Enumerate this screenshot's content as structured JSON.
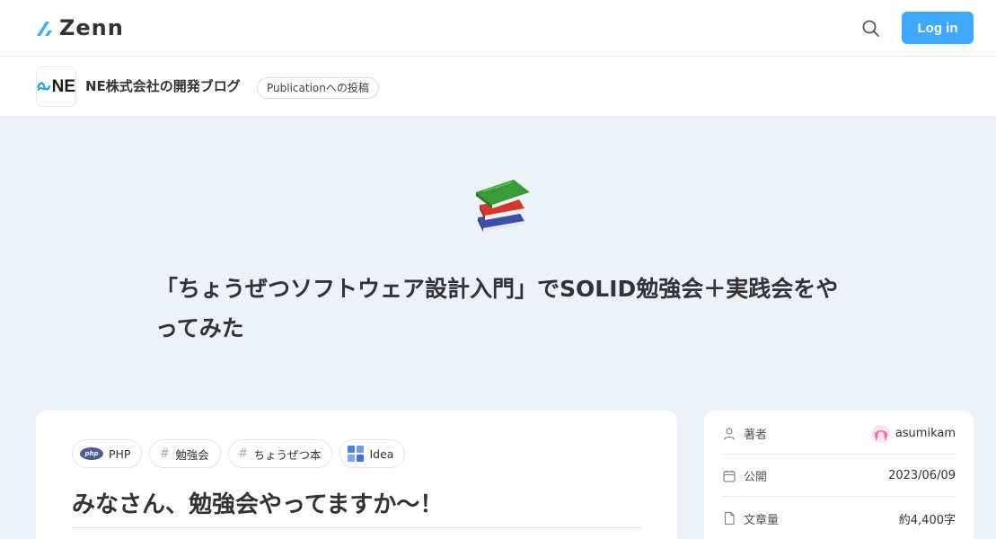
{
  "header": {
    "logo_text": "Zenn",
    "login_label": "Log in",
    "search_icon": "search-icon"
  },
  "publication": {
    "name": "NE株式会社の開発ブログ",
    "avatar_text": "NE",
    "badge": "Publicationへの投稿"
  },
  "article": {
    "emoji": "books",
    "title": "「ちょうぜつソフトウェア設計入門」でSOLID勉強会＋実践会をやってみた",
    "tags": [
      {
        "label": "PHP",
        "icon": "php-icon"
      },
      {
        "label": "勉強会",
        "icon": "hash"
      },
      {
        "label": "ちょうぜつ本",
        "icon": "hash"
      },
      {
        "label": "Idea",
        "icon": "idea-icon"
      }
    ],
    "heading": "みなさん、勉強会やってますか〜！"
  },
  "meta": {
    "author_label": "著者",
    "author_name": "asumikam",
    "published_label": "公開",
    "published_date": "2023/06/09",
    "length_label": "文章量",
    "length_value": "約4,400字"
  },
  "colors": {
    "accent": "#3ea8ff",
    "background": "#edf2f7"
  }
}
